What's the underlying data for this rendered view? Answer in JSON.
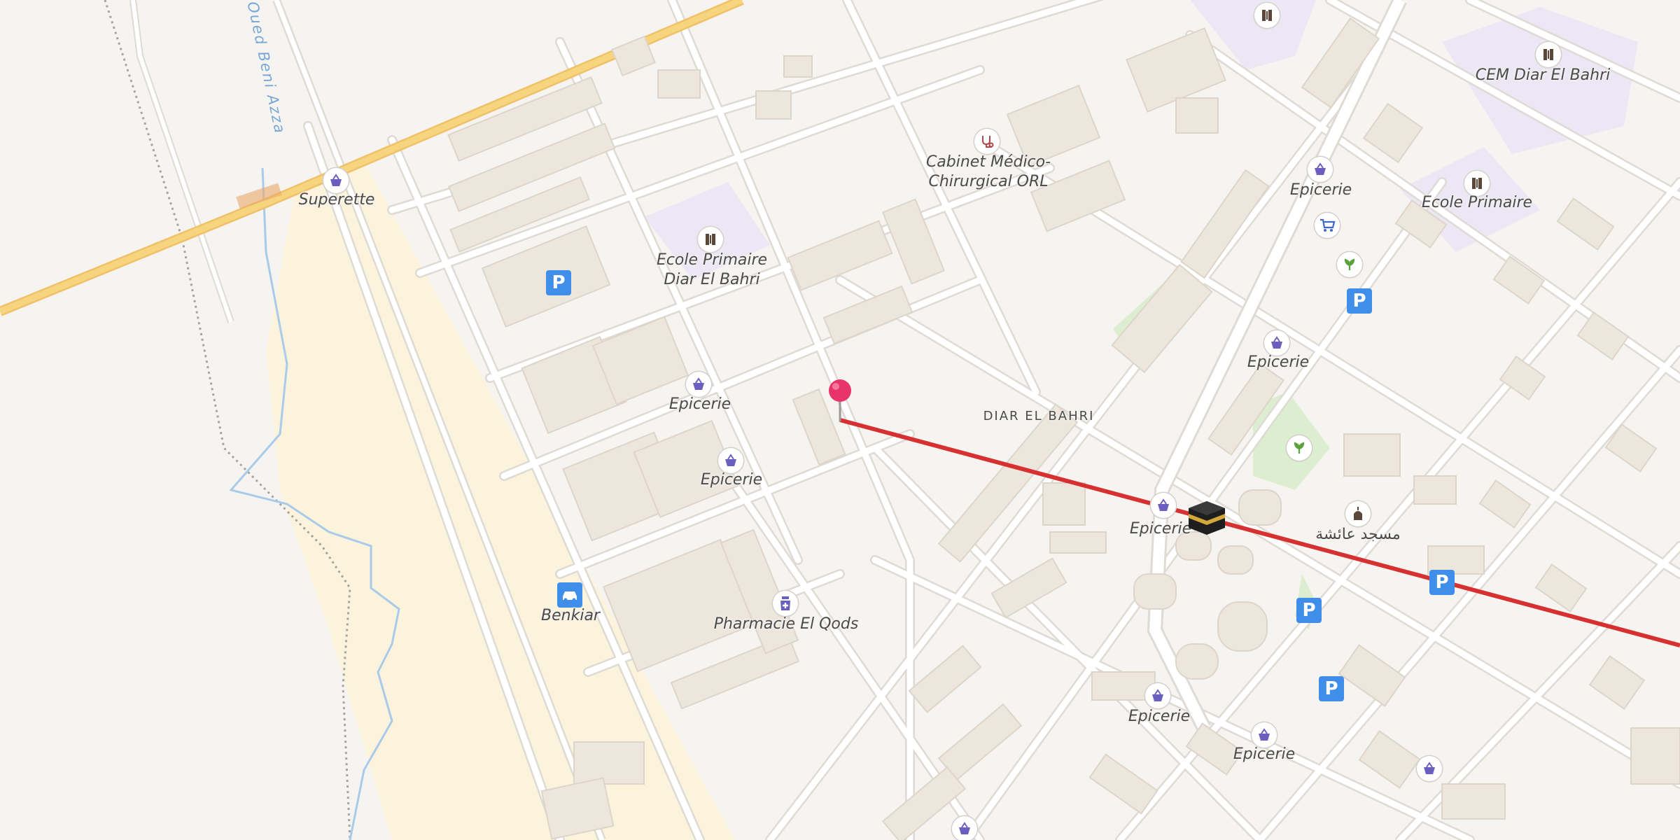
{
  "map": {
    "river_label": "Oued Beni Azza",
    "district_label": "DIAR EL BAHRI",
    "poi": [
      {
        "id": "superette",
        "name": "Superette",
        "icon": "basket-icon"
      },
      {
        "id": "ecole-primaire-1",
        "name": "Ecole Primaire\nDiar El Bahri",
        "icon": "school-icon"
      },
      {
        "id": "cabinet",
        "name": "Cabinet Médico-\nChirurgical ORL",
        "icon": "stethoscope-icon"
      },
      {
        "id": "cem",
        "name": "CEM Diar El Bahri",
        "icon": "school-icon"
      },
      {
        "id": "ecole-primaire-2",
        "name": "Ecole Primaire",
        "icon": "school-icon"
      },
      {
        "id": "epicerie-1",
        "name": "Epicerie",
        "icon": "basket-icon"
      },
      {
        "id": "epicerie-2",
        "name": "Epicerie",
        "icon": "basket-icon"
      },
      {
        "id": "epicerie-3",
        "name": "Epicerie",
        "icon": "basket-icon"
      },
      {
        "id": "epicerie-4",
        "name": "Epicerie",
        "icon": "basket-icon"
      },
      {
        "id": "epicerie-5",
        "name": "Epicerie",
        "icon": "basket-icon"
      },
      {
        "id": "epicerie-6",
        "name": "Epicerie",
        "icon": "basket-icon"
      },
      {
        "id": "epicerie-7",
        "name": "Epicerie",
        "icon": "basket-icon"
      },
      {
        "id": "mosque",
        "name": "مسجد عائشة",
        "icon": "mosque-icon"
      },
      {
        "id": "benkiar",
        "name": "Benkiar",
        "icon": "car-icon"
      },
      {
        "id": "pharmacie",
        "name": "Pharmacie El Qods",
        "icon": "pharmacy-icon"
      }
    ],
    "parking_glyph": "P",
    "colors": {
      "background": "#f6f4f1",
      "building": "#ece6dd",
      "road": "#ffffff",
      "road_casing": "#dedad4",
      "trunk_road": "#f7d57f",
      "sand": "#fbf3dc",
      "school_area": "#ebe7f5",
      "park": "#dcedd0",
      "river": "#a9cbe9",
      "qibla_line": "#d73030",
      "pin": "#e8336b",
      "parking": "#3f8eea",
      "basket": "#6a5fbf"
    }
  }
}
